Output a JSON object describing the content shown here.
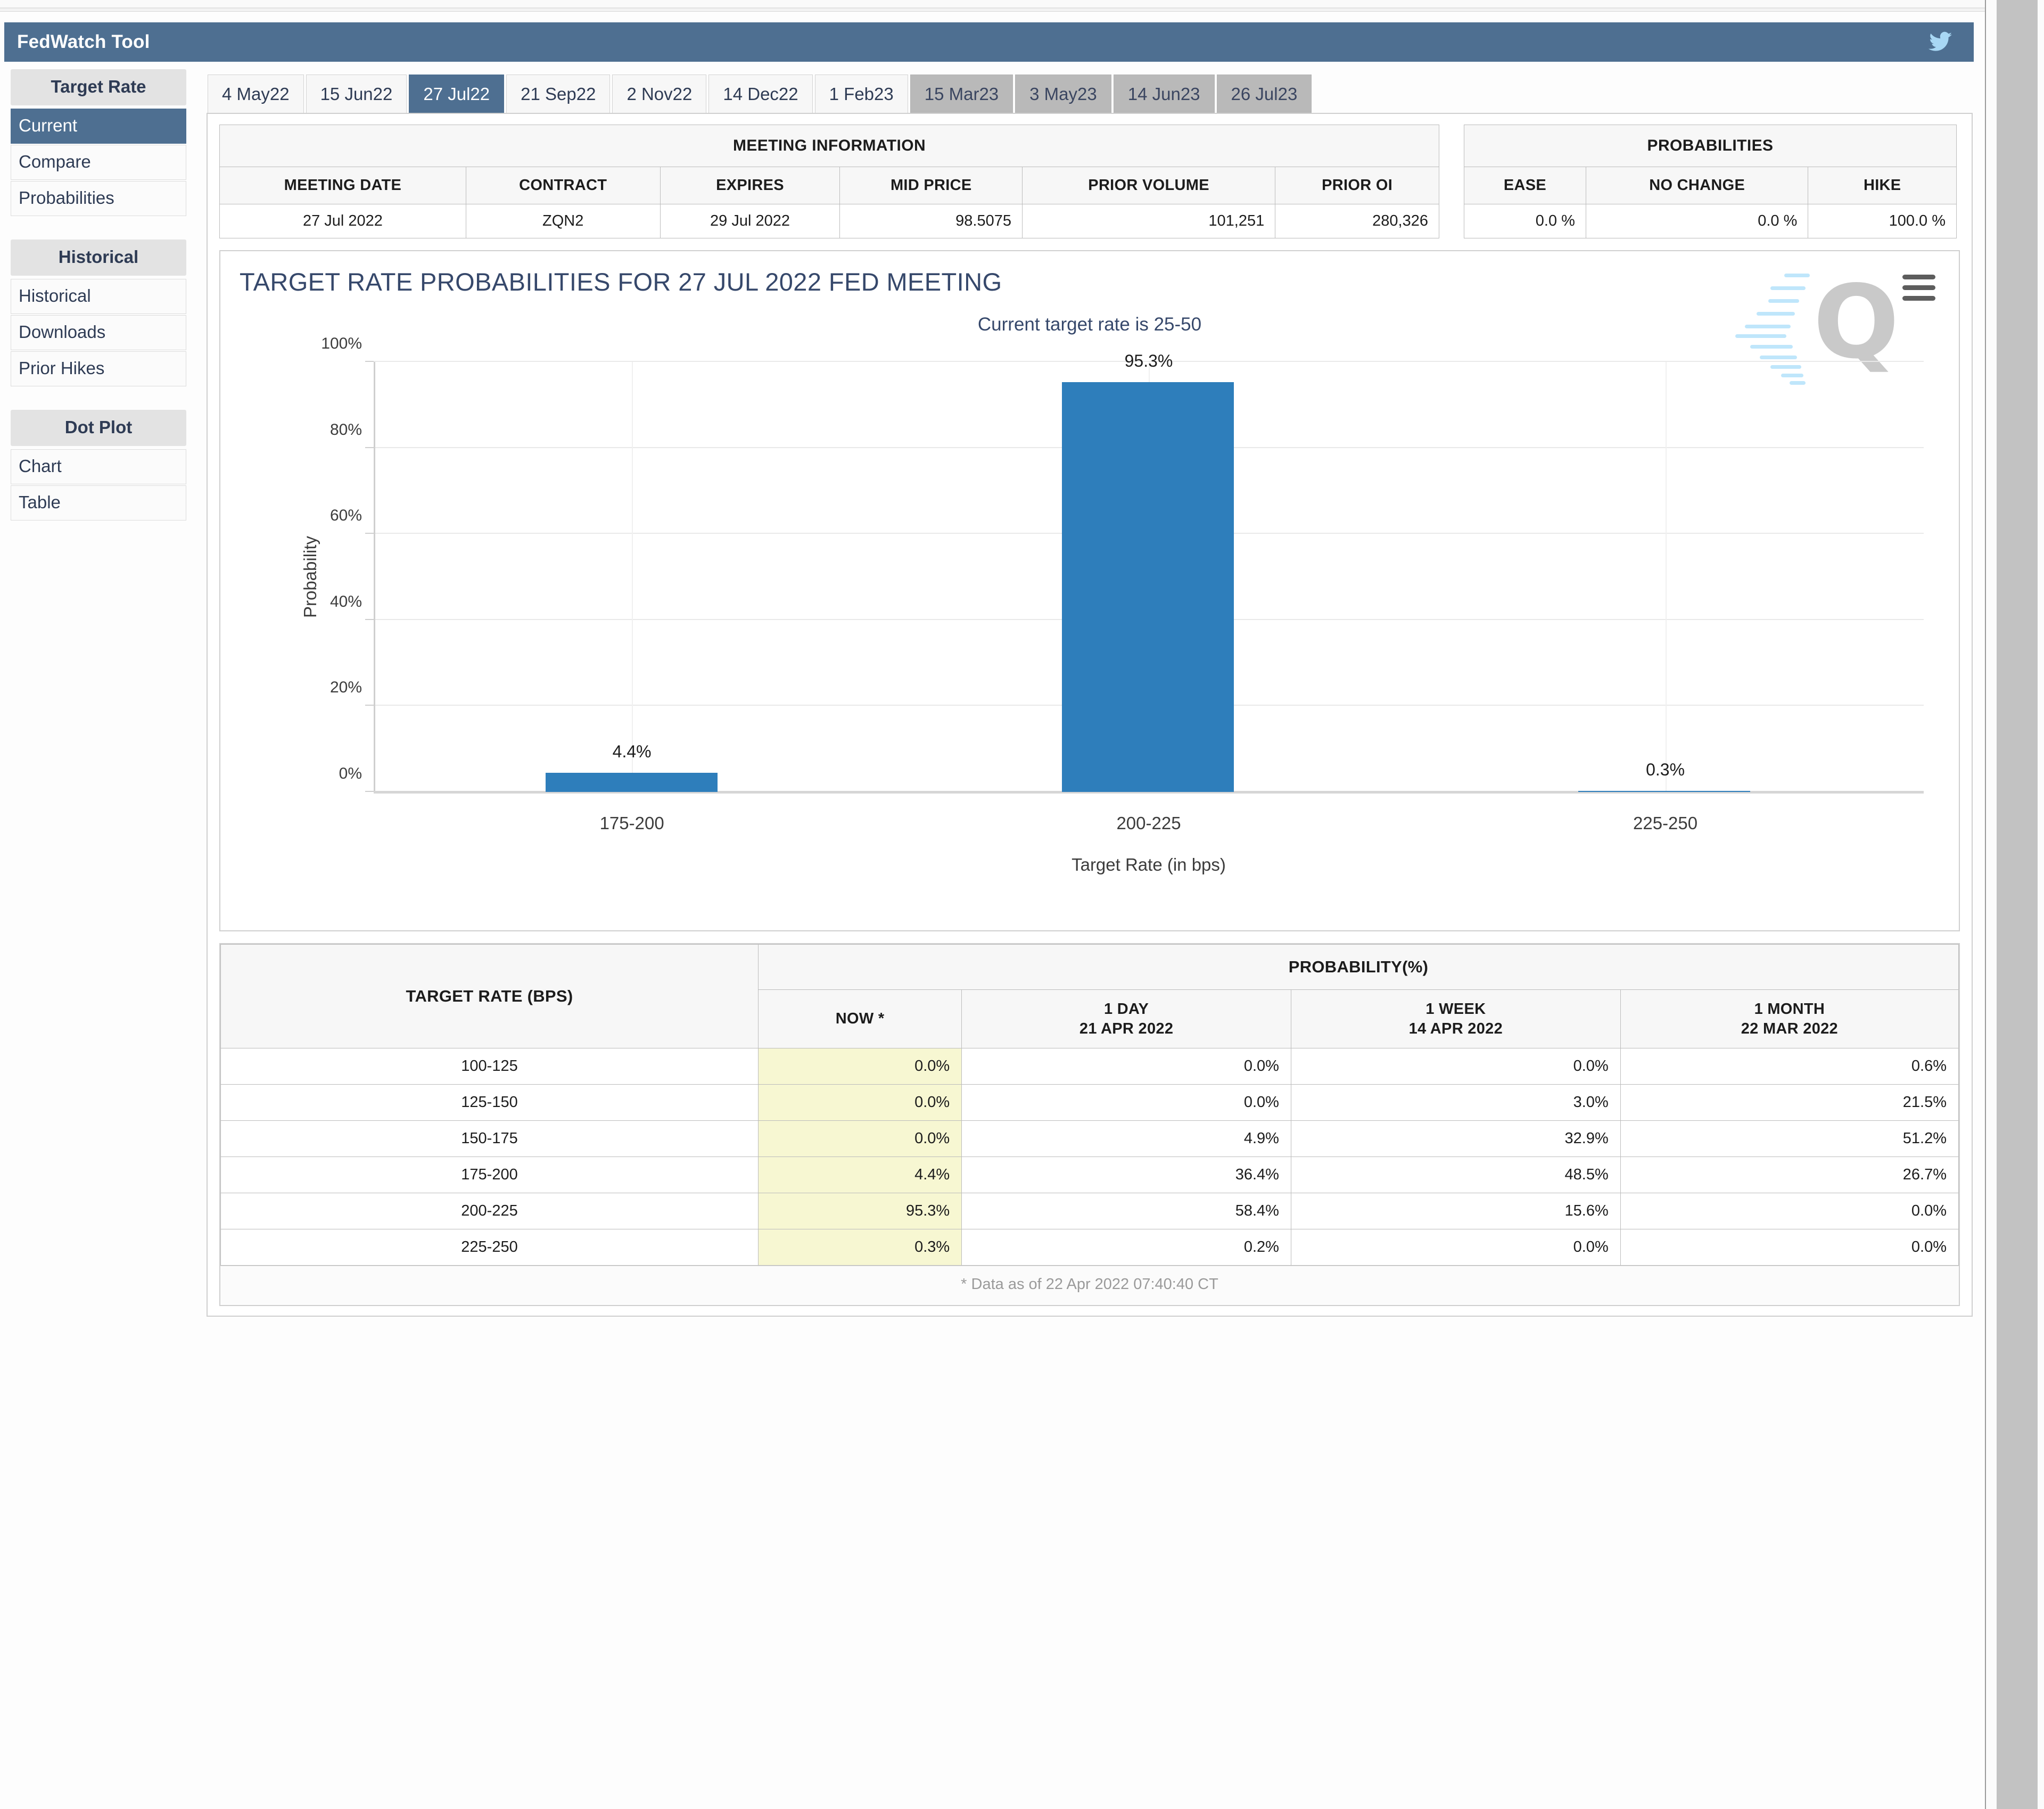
{
  "app": {
    "title": "FedWatch Tool",
    "twitter_icon": "twitter-bird-icon",
    "hamburger_icon": "hamburger-menu-icon",
    "watermark_letter": "Q"
  },
  "sidebar": {
    "groups": [
      {
        "header": "Target Rate",
        "items": [
          {
            "label": "Current",
            "active": true
          },
          {
            "label": "Compare",
            "active": false
          },
          {
            "label": "Probabilities",
            "active": false
          }
        ]
      },
      {
        "header": "Historical",
        "items": [
          {
            "label": "Historical",
            "active": false
          },
          {
            "label": "Downloads",
            "active": false
          },
          {
            "label": "Prior Hikes",
            "active": false
          }
        ]
      },
      {
        "header": "Dot Plot",
        "items": [
          {
            "label": "Chart",
            "active": false
          },
          {
            "label": "Table",
            "active": false
          }
        ]
      }
    ]
  },
  "tabs": [
    {
      "label": "4 May22",
      "state": "normal"
    },
    {
      "label": "15 Jun22",
      "state": "normal"
    },
    {
      "label": "27 Jul22",
      "state": "active"
    },
    {
      "label": "21 Sep22",
      "state": "normal"
    },
    {
      "label": "2 Nov22",
      "state": "normal"
    },
    {
      "label": "14 Dec22",
      "state": "normal"
    },
    {
      "label": "1 Feb23",
      "state": "normal"
    },
    {
      "label": "15 Mar23",
      "state": "disabled"
    },
    {
      "label": "3 May23",
      "state": "disabled"
    },
    {
      "label": "14 Jun23",
      "state": "disabled"
    },
    {
      "label": "26 Jul23",
      "state": "disabled"
    }
  ],
  "meeting_information": {
    "title": "MEETING INFORMATION",
    "headers": [
      "MEETING DATE",
      "CONTRACT",
      "EXPIRES",
      "MID PRICE",
      "PRIOR VOLUME",
      "PRIOR OI"
    ],
    "row": {
      "meeting_date": "27 Jul 2022",
      "contract": "ZQN2",
      "expires": "29 Jul 2022",
      "mid_price": "98.5075",
      "prior_volume": "101,251",
      "prior_oi": "280,326"
    }
  },
  "probabilities_summary": {
    "title": "PROBABILITIES",
    "headers": [
      "EASE",
      "NO CHANGE",
      "HIKE"
    ],
    "row": {
      "ease": "0.0 %",
      "no_change": "0.0 %",
      "hike": "100.0 %"
    }
  },
  "chart_data": {
    "type": "bar",
    "title": "TARGET RATE PROBABILITIES FOR 27 JUL 2022 FED MEETING",
    "subtitle": "Current target rate is 25-50",
    "categories": [
      "175-200",
      "200-225",
      "225-250"
    ],
    "values": [
      4.4,
      95.3,
      0.3
    ],
    "data_labels": [
      "4.4%",
      "95.3%",
      "0.3%"
    ],
    "xlabel": "Target Rate (in bps)",
    "ylabel": "Probability",
    "ylim": [
      0,
      100
    ],
    "yticks": [
      0,
      20,
      40,
      60,
      80,
      100
    ],
    "ytick_labels": [
      "0%",
      "20%",
      "40%",
      "60%",
      "80%",
      "100%"
    ],
    "grid": true,
    "legend": "none",
    "bar_color": "#2e7ebb"
  },
  "probability_table": {
    "rate_header": "TARGET RATE (BPS)",
    "group_header": "PROBABILITY(%)",
    "columns": [
      {
        "top": "NOW *",
        "bottom": ""
      },
      {
        "top": "1 DAY",
        "bottom": "21 APR 2022"
      },
      {
        "top": "1 WEEK",
        "bottom": "14 APR 2022"
      },
      {
        "top": "1 MONTH",
        "bottom": "22 MAR 2022"
      }
    ],
    "rows": [
      {
        "rate": "100-125",
        "now": "0.0%",
        "day": "0.0%",
        "week": "0.0%",
        "month": "0.6%"
      },
      {
        "rate": "125-150",
        "now": "0.0%",
        "day": "0.0%",
        "week": "3.0%",
        "month": "21.5%"
      },
      {
        "rate": "150-175",
        "now": "0.0%",
        "day": "4.9%",
        "week": "32.9%",
        "month": "51.2%"
      },
      {
        "rate": "175-200",
        "now": "4.4%",
        "day": "36.4%",
        "week": "48.5%",
        "month": "26.7%"
      },
      {
        "rate": "200-225",
        "now": "95.3%",
        "day": "58.4%",
        "week": "15.6%",
        "month": "0.0%"
      },
      {
        "rate": "225-250",
        "now": "0.3%",
        "day": "0.2%",
        "week": "0.0%",
        "month": "0.0%"
      }
    ],
    "footnote": "* Data as of 22 Apr 2022 07:40:40 CT"
  },
  "colors": {
    "brand": "#4e6f91",
    "bar": "#2e7ebb",
    "highlight": "#f7f7d2",
    "title_text": "#36486b"
  }
}
